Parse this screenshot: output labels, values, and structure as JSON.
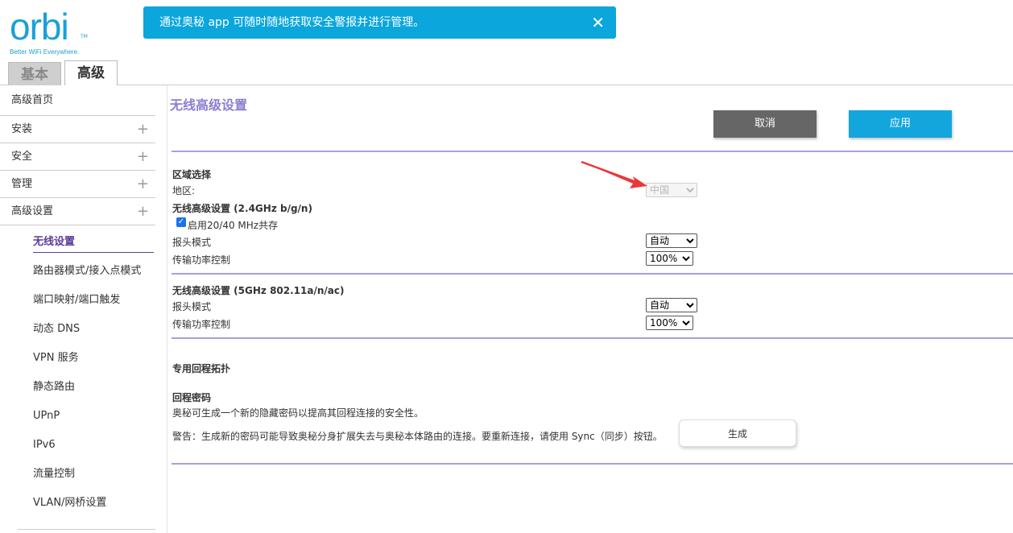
{
  "logo": {
    "word": "orbi",
    "tm": "TM",
    "tagline": "Better WiFi Everywhere."
  },
  "banner": {
    "text": "通过奥秘 app 可随时随地获取安全警报并进行管理。",
    "close": "✕"
  },
  "tabs": {
    "basic": "基本",
    "advanced": "高级"
  },
  "sidebar": {
    "top_items": [
      {
        "label": "高级首页",
        "plus": ""
      },
      {
        "label": "安装",
        "plus": "+"
      },
      {
        "label": "安全",
        "plus": "+"
      },
      {
        "label": "管理",
        "plus": "+"
      },
      {
        "label": "高级设置",
        "plus": "+"
      }
    ],
    "sub_items": [
      "无线设置",
      "路由器模式/接入点模式",
      "端口映射/端口触发",
      "动态 DNS",
      "VPN 服务",
      "静态路由",
      "UPnP",
      "IPv6",
      "流量控制",
      "VLAN/网桥设置"
    ]
  },
  "main": {
    "title": "无线高级设置",
    "cancel": "取消",
    "apply": "应用",
    "region": {
      "heading": "区域选择",
      "label": "地区:",
      "value": "中国"
    },
    "band24": {
      "heading": "无线高级设置 (2.4GHz b/g/n)",
      "coexist_label": "启用20/40 MHz共存",
      "coexist_checked": true,
      "preamble_label": "报头模式",
      "preamble_value": "自动",
      "power_label": "传输功率控制",
      "power_value": "100%"
    },
    "band5": {
      "heading": "无线高级设置 (5GHz 802.11a/n/ac)",
      "preamble_label": "报头模式",
      "preamble_value": "自动",
      "power_label": "传输功率控制",
      "power_value": "100%"
    },
    "backhaul": {
      "heading": "专用回程拓扑",
      "password_heading": "回程密码",
      "description": "奥秘可生成一个新的隐藏密码以提高其回程连接的安全性。",
      "warning": "警告：生成新的密码可能导致奥秘分身扩展失去与奥秘本体路由的连接。要重新连接，请使用 Sync（同步）按钮。",
      "generate": "生成"
    }
  },
  "colors": {
    "accent": "#12a6dd",
    "title": "#8a7fd0",
    "divider": "#a99ee0",
    "active_nav": "#5b3c9a",
    "arrow": "#e8393a"
  }
}
